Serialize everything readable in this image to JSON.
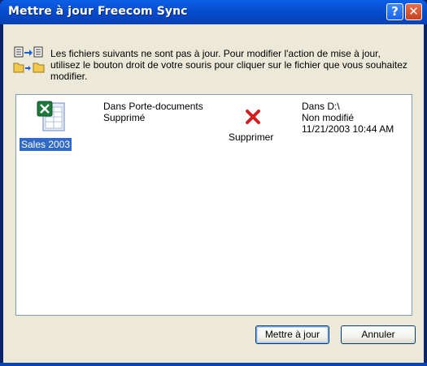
{
  "window": {
    "title": "Mettre à jour Freecom Sync",
    "help_label": "?",
    "close_label": "✕"
  },
  "info": {
    "icon": "sync-files-icon",
    "text": "Les fichiers suivants ne sont pas à jour. Pour modifier l'action de mise à jour, utilisez le bouton droit de votre souris pour cliquer sur le fichier que vous souhaitez modifier."
  },
  "file": {
    "name": "Sales 2003",
    "icon": "excel-file-icon",
    "source_line1": "Dans Porte-documents",
    "source_line2": "Supprimé",
    "action_icon": "delete-x-icon",
    "action_label": "Supprimer",
    "dest_line1": "Dans D:\\",
    "dest_line2": "Non modifié",
    "dest_line3": "11/21/2003 10:44 AM"
  },
  "buttons": {
    "update_label": "Mettre à jour",
    "cancel_label": "Annuler"
  },
  "colors": {
    "titlebar": "#0a53d6",
    "selection": "#316ac5",
    "delete_x": "#d21e1e",
    "dialog_bg": "#ece9d8"
  }
}
